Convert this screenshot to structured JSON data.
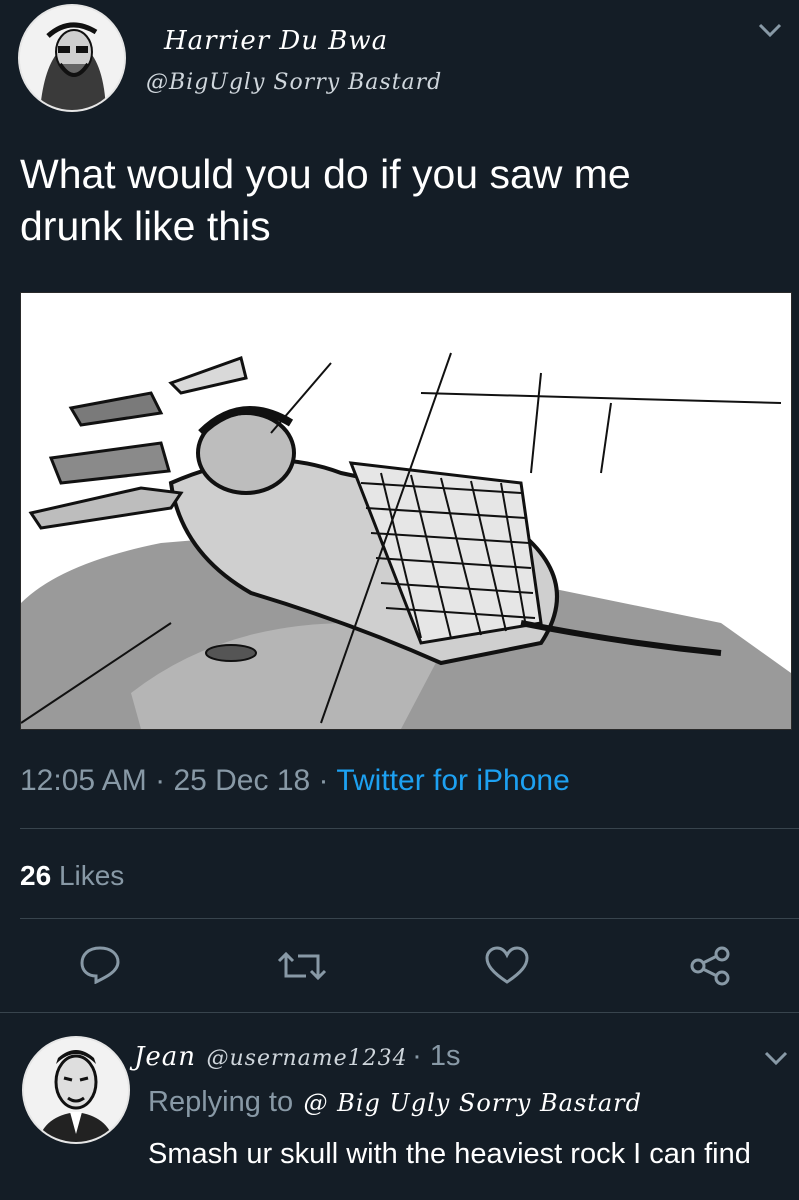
{
  "tweet": {
    "author_name": "Harrier Du Bwa",
    "author_handle": "@BigUgly Sorry Bastard",
    "text_line1": "What would you do if you saw me",
    "text_line2": "drunk like this",
    "time": "12:05 AM",
    "date": "25 Dec 18",
    "source": "Twitter for iPhone",
    "likes_count": "26",
    "likes_label": "Likes"
  },
  "reply": {
    "author_name": "Jean",
    "author_handle": "@username1234",
    "time_ago": "1s",
    "replying_prefix": "Replying to",
    "replying_handle": "@ Big Ugly Sorry Bastard",
    "text": "Smash ur skull with the heaviest rock I can find"
  },
  "icons": {
    "chevron": "chevron-down-icon",
    "reply": "reply-icon",
    "retweet": "retweet-icon",
    "like": "heart-icon",
    "share": "share-icon"
  },
  "colors": {
    "background": "#141d26",
    "secondary_text": "#8899a6",
    "link": "#1da1f2",
    "divider": "#38444d"
  }
}
